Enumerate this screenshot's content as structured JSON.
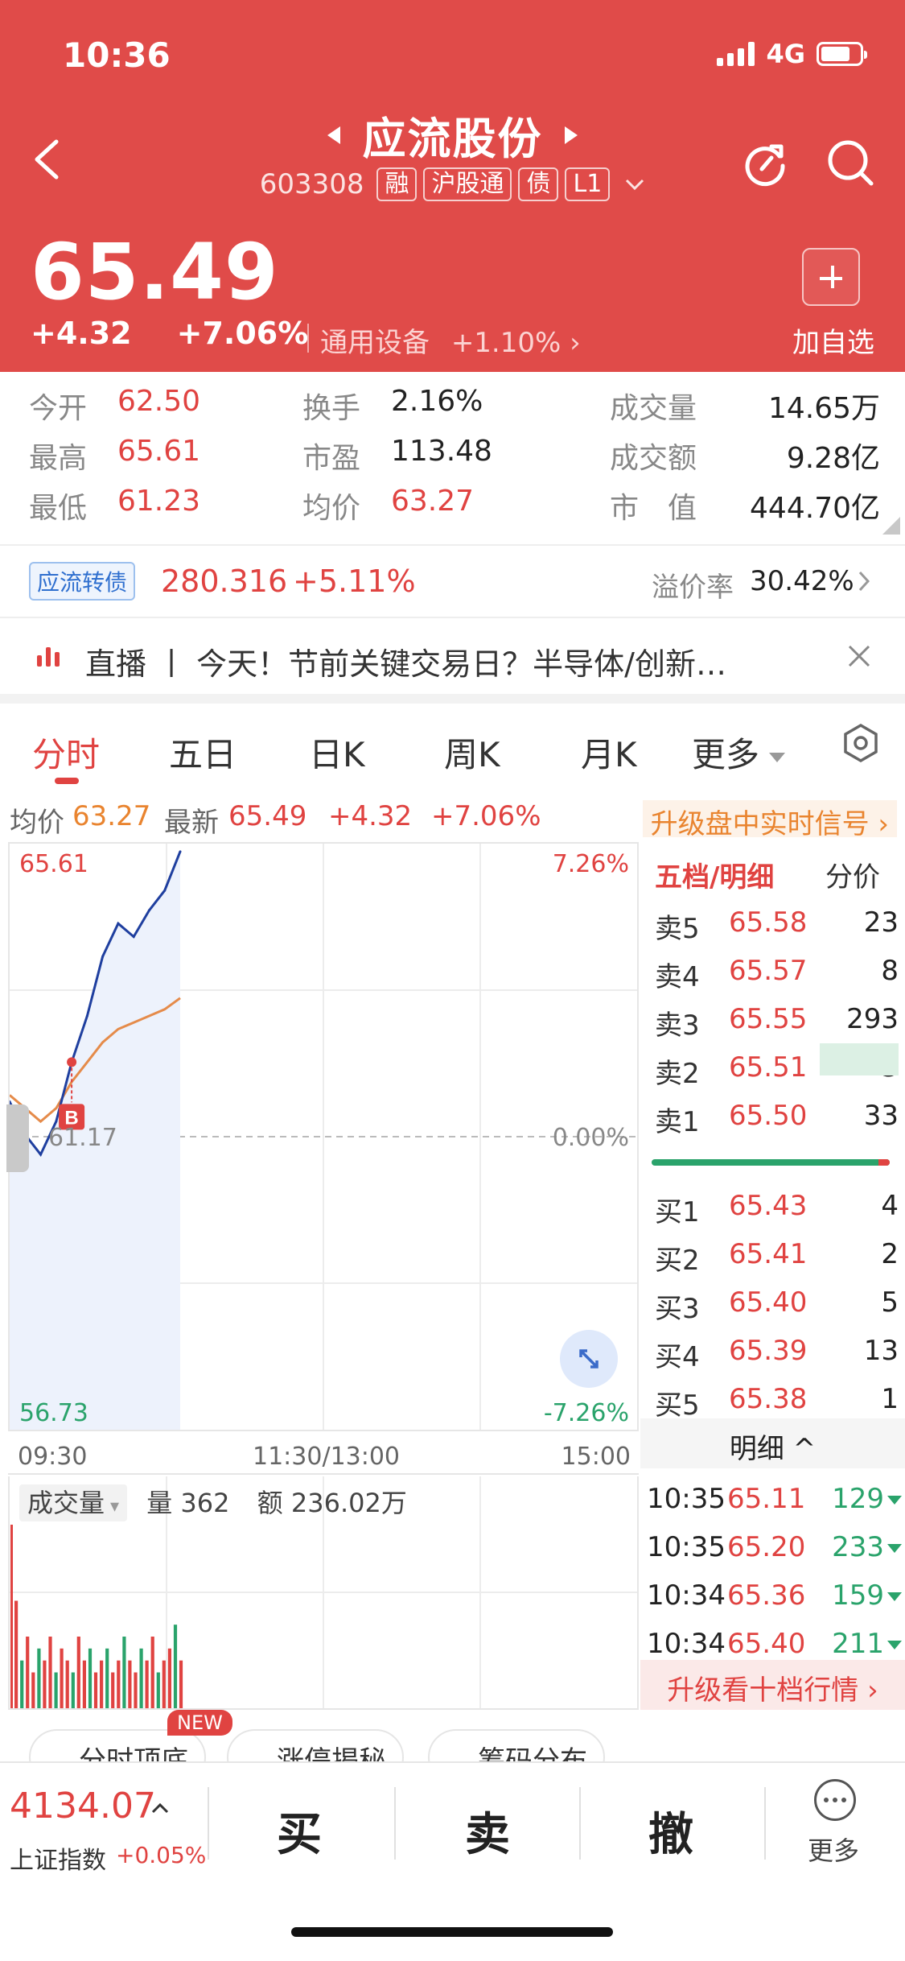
{
  "status": {
    "time": "10:36",
    "network": "4G"
  },
  "header": {
    "title": "应流股份",
    "code": "603308",
    "tags": [
      "融",
      "沪股通",
      "债",
      "L1"
    ],
    "price": "65.49",
    "change": "+4.32",
    "change_pct": "+7.06%",
    "industry": "通用设备",
    "industry_chg": "+1.10%",
    "add_label": "加自选",
    "colors": {
      "header_bg": "#e04b49",
      "up": "#e04341",
      "down": "#2aa36b"
    }
  },
  "stats": {
    "open_k": "今开",
    "open_v": "62.50",
    "high_k": "最高",
    "high_v": "65.61",
    "low_k": "最低",
    "low_v": "61.23",
    "turnover_k": "换手",
    "turnover_v": "2.16%",
    "pe_k": "市盈",
    "pe_v": "113.48",
    "avg_k": "均价",
    "avg_v": "63.27",
    "vol_k": "成交量",
    "vol_v": "14.65万",
    "amt_k": "成交额",
    "amt_v": "9.28亿",
    "mcap_k": "市　值",
    "mcap_v": "444.70亿"
  },
  "bond": {
    "tag": "应流转债",
    "price": "280.316",
    "chg": "+5.11%",
    "premium_k": "溢价率",
    "premium_v": "30.42%"
  },
  "news": {
    "text": "直播 丨 今天！节前关键交易日？半导体/创新…"
  },
  "tabs": [
    "分时",
    "五日",
    "日K",
    "周K",
    "月K",
    "更多"
  ],
  "info": {
    "avg_k": "均价",
    "avg_v": "63.27",
    "last_k": "最新",
    "last_v": "65.49",
    "chg": "+4.32",
    "pct": "+7.06%",
    "upgrade": "升级盘中实时信号 ›"
  },
  "chart": {
    "ymax": "65.61",
    "ymid": "61.17",
    "ymin": "56.73",
    "pmax": "7.26%",
    "pmid": "0.00%",
    "pmin": "-7.26%",
    "t_open": "09:30",
    "t_mid": "11:30/13:00",
    "t_close": "15:00",
    "marker": "B"
  },
  "chart_data": {
    "type": "line",
    "ylim": [
      56.73,
      65.61
    ],
    "x": [
      "09:30",
      "09:36",
      "09:42",
      "09:48",
      "09:54",
      "10:00",
      "10:06",
      "10:12",
      "10:18",
      "10:24",
      "10:30",
      "10:35"
    ],
    "series": [
      {
        "name": "最新",
        "values": [
          61.7,
          61.2,
          60.9,
          61.4,
          62.3,
          63.0,
          63.9,
          64.4,
          64.2,
          64.6,
          64.9,
          65.49
        ]
      },
      {
        "name": "均价",
        "values": [
          61.8,
          61.6,
          61.4,
          61.6,
          62.0,
          62.3,
          62.6,
          62.8,
          62.9,
          63.0,
          63.1,
          63.27
        ]
      }
    ],
    "volume": [
      9,
      4,
      6,
      3,
      5,
      4,
      6,
      3,
      5,
      4,
      3,
      6,
      4,
      5,
      3,
      4,
      5,
      3,
      4,
      6,
      4,
      3,
      5,
      4,
      6,
      3,
      4,
      5,
      7,
      4
    ]
  },
  "volume": {
    "label": "成交量",
    "qty_k": "量",
    "qty_v": "362",
    "amt_k": "额",
    "amt_v": "236.02万"
  },
  "orderbook": {
    "title": "五档/明细",
    "alt": "分价",
    "asks": [
      {
        "l": "卖5",
        "p": "65.58",
        "q": "23"
      },
      {
        "l": "卖4",
        "p": "65.57",
        "q": "8"
      },
      {
        "l": "卖3",
        "p": "65.55",
        "q": "293"
      },
      {
        "l": "卖2",
        "p": "65.51",
        "q": "3"
      },
      {
        "l": "卖1",
        "p": "65.50",
        "q": "33"
      }
    ],
    "bids": [
      {
        "l": "买1",
        "p": "65.43",
        "q": "4"
      },
      {
        "l": "买2",
        "p": "65.41",
        "q": "2"
      },
      {
        "l": "买3",
        "p": "65.40",
        "q": "5"
      },
      {
        "l": "买4",
        "p": "65.39",
        "q": "13"
      },
      {
        "l": "买5",
        "p": "65.38",
        "q": "1"
      }
    ],
    "detail": "明细 ^",
    "trades": [
      {
        "t": "10:35",
        "p": "65.11",
        "q": "129"
      },
      {
        "t": "10:35",
        "p": "65.20",
        "q": "233"
      },
      {
        "t": "10:34",
        "p": "65.36",
        "q": "159"
      },
      {
        "t": "10:34",
        "p": "65.40",
        "q": "211"
      }
    ],
    "upgrade": "升级看十档行情 ›"
  },
  "pills": [
    "分时顶底",
    "涨停揭秘",
    "筹码分布"
  ],
  "new_badge": "NEW",
  "bottom": {
    "index_val": "4134.07",
    "index_name": "上证指数",
    "index_chg": "+0.05%",
    "buy": "买",
    "sell": "卖",
    "cancel": "撤",
    "more": "更多"
  }
}
